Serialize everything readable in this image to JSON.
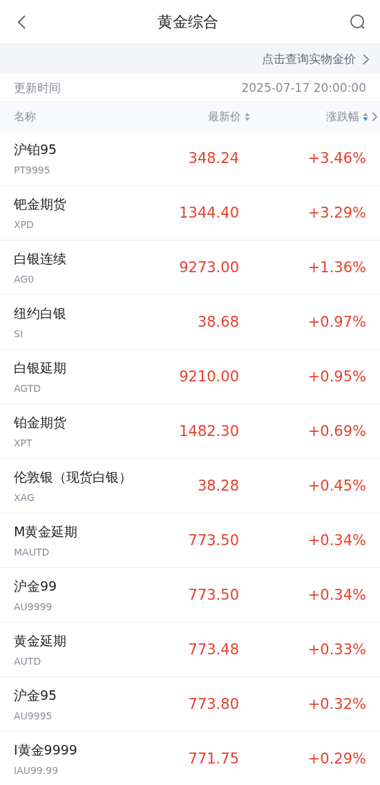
{
  "header": {
    "title": "黄金综合"
  },
  "banner": {
    "text": "点击查询实物金价"
  },
  "update": {
    "label": "更新时间",
    "time": "2025-07-17 20:00:00"
  },
  "columns": [
    {
      "label": "名称"
    },
    {
      "label": "最新价",
      "sorted_desc": false
    },
    {
      "label": "涨跌幅",
      "sorted_desc": true
    }
  ],
  "rows": [
    {
      "name": "沪铂95",
      "code": "PT9995",
      "price": "348.24",
      "change": "+3.46%"
    },
    {
      "name": "钯金期货",
      "code": "XPD",
      "price": "1344.40",
      "change": "+3.29%"
    },
    {
      "name": "白银连续",
      "code": "AG0",
      "price": "9273.00",
      "change": "+1.36%"
    },
    {
      "name": "纽约白银",
      "code": "SI",
      "price": "38.68",
      "change": "+0.97%"
    },
    {
      "name": "白银延期",
      "code": "AGTD",
      "price": "9210.00",
      "change": "+0.95%"
    },
    {
      "name": "铂金期货",
      "code": "XPT",
      "price": "1482.30",
      "change": "+0.69%"
    },
    {
      "name": "伦敦银（现货白银）",
      "code": "XAG",
      "price": "38.28",
      "change": "+0.45%"
    },
    {
      "name": "M黄金延期",
      "code": "MAUTD",
      "price": "773.50",
      "change": "+0.34%"
    },
    {
      "name": "沪金99",
      "code": "AU9999",
      "price": "773.50",
      "change": "+0.34%"
    },
    {
      "name": "黄金延期",
      "code": "AUTD",
      "price": "773.48",
      "change": "+0.33%"
    },
    {
      "name": "沪金95",
      "code": "AU9995",
      "price": "773.80",
      "change": "+0.32%"
    },
    {
      "name": "I黄金9999",
      "code": "IAU99.99",
      "price": "771.75",
      "change": "+0.29%"
    }
  ]
}
